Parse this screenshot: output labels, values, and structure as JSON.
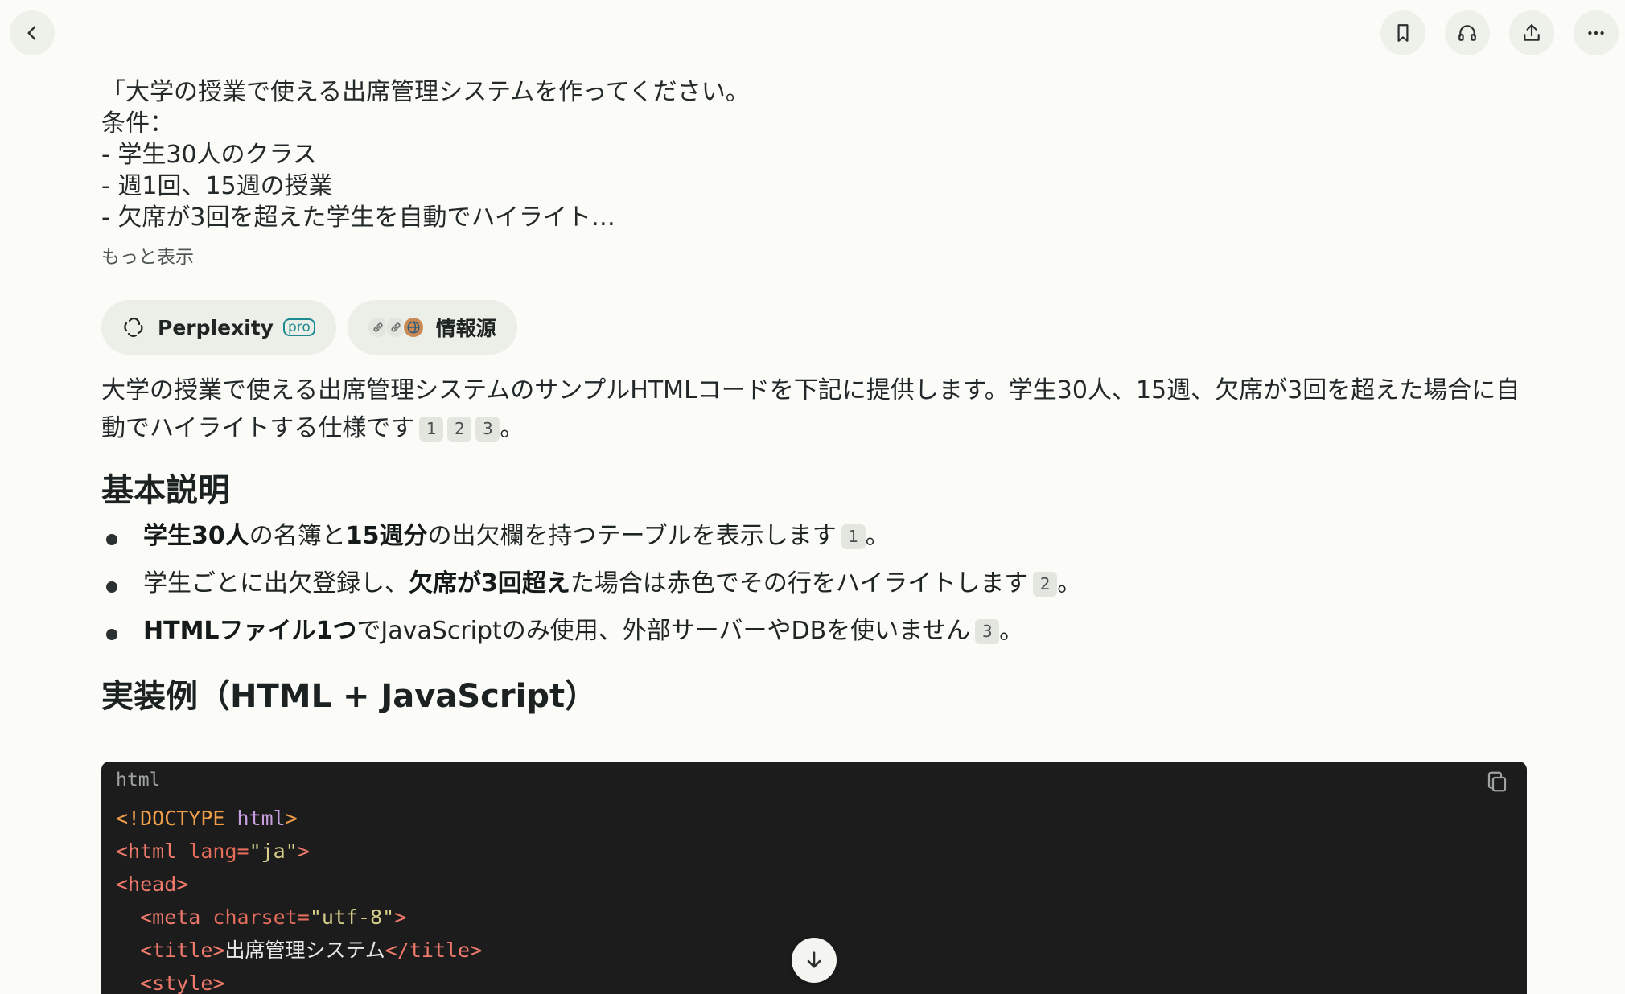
{
  "topbar": {
    "back_icon": "chevron-left-icon",
    "actions": [
      "bookmark-icon",
      "headphones-icon",
      "share-icon",
      "more-icon"
    ]
  },
  "query": {
    "lines": [
      "「大学の授業で使える出席管理システムを作ってください。",
      "条件：",
      "- 学生30人のクラス",
      "- 週1回、15週の授業",
      "- 欠席が3回を超えた学生を自動でハイライト…"
    ],
    "more_label": "もっと表示"
  },
  "chips": {
    "perplexity_label": "Perplexity",
    "pro_label": "pro",
    "sources_label": "情報源"
  },
  "answer": {
    "intro": "大学の授業で使える出席管理システムのサンプルHTMLコードを下記に提供します。学生30人、15週、欠席が3回を超えた場合に自動でハイライトする仕様です",
    "intro_citations": [
      "1",
      "2",
      "3"
    ],
    "intro_end": "。",
    "heading1": "基本説明",
    "bullets": [
      {
        "b1": "学生30人",
        "t1": "の名簿と",
        "b2": "15週分",
        "t2": "の出欠欄を持つテーブルを表示します",
        "cite": "1",
        "end": "。"
      },
      {
        "t0": "学生ごとに出欠登録し、",
        "b1": "欠席が3回超え",
        "t1": "た場合は赤色でその行をハイライトします",
        "cite": "2",
        "end": "。"
      },
      {
        "b1": "HTMLファイル1つ",
        "t1": "でJavaScriptのみ使用、外部サーバーやDBを使いません",
        "cite": "3",
        "end": "。"
      }
    ],
    "heading2": "実装例（HTML + JavaScript）"
  },
  "code": {
    "lang": "html",
    "line1_a": "<!DOCTYPE ",
    "line1_b": "html",
    "line1_c": ">",
    "line2_a": "<html ",
    "line2_b": "lang=",
    "line2_c": "\"ja\"",
    "line2_d": ">",
    "line3": "<head>",
    "line4_a": "  <meta ",
    "line4_b": "charset=",
    "line4_c": "\"utf-8\"",
    "line4_d": ">",
    "line5_a": "  <title>",
    "line5_b": "出席管理システム",
    "line5_c": "</title>",
    "line6": "  <style>"
  },
  "colors": {
    "background": "#fbfcf8",
    "code_bg": "#1c1c1c",
    "accent": "#1d8a90"
  }
}
